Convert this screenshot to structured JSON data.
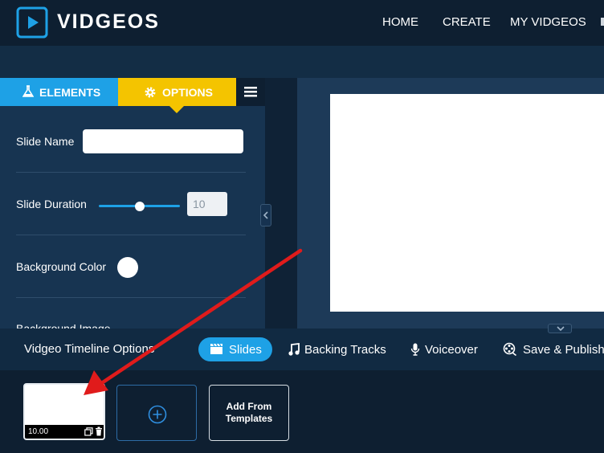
{
  "brand": {
    "name": "VIDGEOS"
  },
  "nav": [
    {
      "label": "HOME"
    },
    {
      "label": "CREATE"
    },
    {
      "label": "MY VIDGEOS"
    }
  ],
  "panel": {
    "tabs": {
      "elements": "ELEMENTS",
      "options": "OPTIONS"
    },
    "slide_name_label": "Slide Name",
    "slide_name_value": "",
    "slide_duration_label": "Slide Duration",
    "slide_duration_value": "10",
    "background_color_label": "Background Color",
    "background_color": "#ffffff",
    "background_image_label": "Background Image"
  },
  "timeline": {
    "title": "Vidgeo Timeline Options",
    "items": {
      "slides": "Slides",
      "backing_tracks": "Backing Tracks",
      "voiceover": "Voiceover",
      "save_publish": "Save & Publish"
    },
    "slides": [
      {
        "duration": "10.00"
      }
    ],
    "add_from_templates": "Add From Templates"
  },
  "colors": {
    "accent_blue": "#1ea1e6",
    "accent_yellow": "#f4c400",
    "nav_bg": "#0e1f31",
    "arrow": "#e01b1b"
  }
}
